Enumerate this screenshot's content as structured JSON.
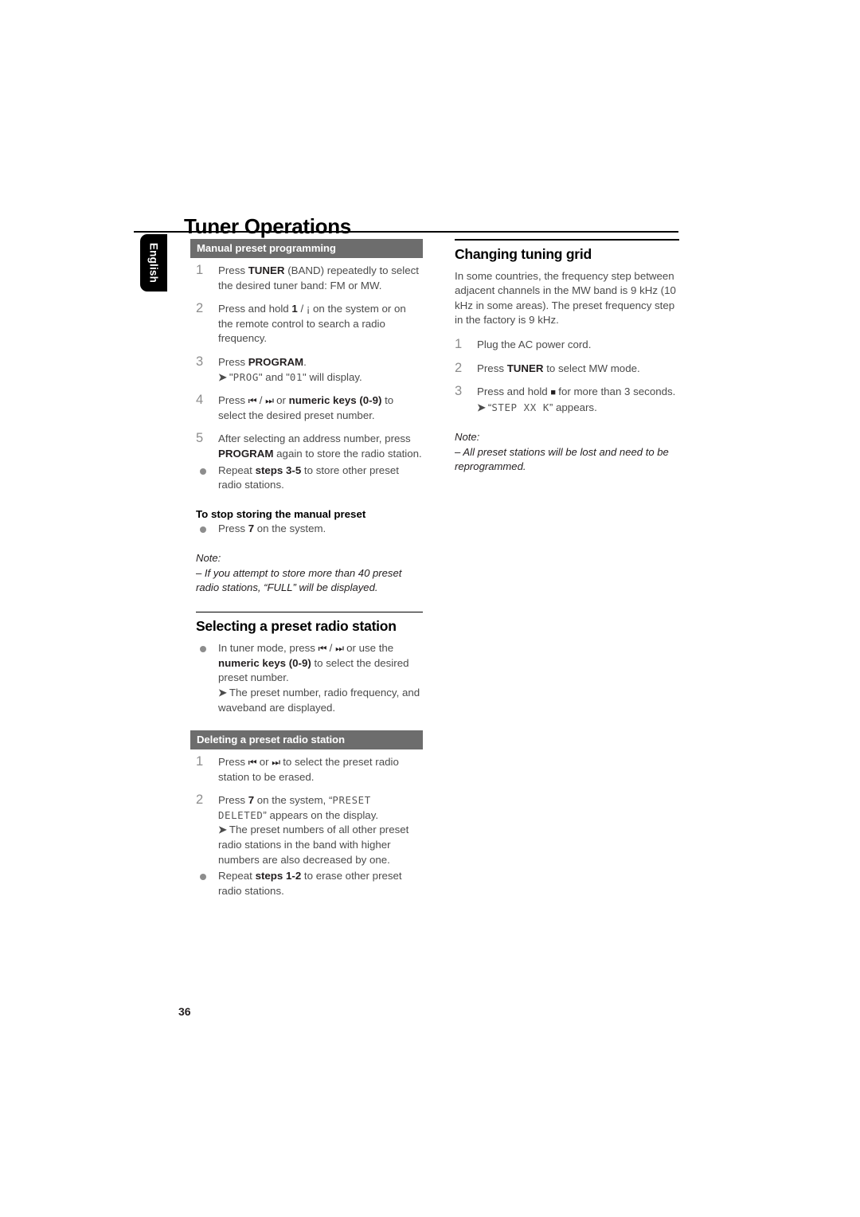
{
  "document": {
    "title": "Tuner Operations",
    "language_tab": "English",
    "page_number": "36"
  },
  "left_column": {
    "manual_preset": {
      "bar_heading": "Manual preset programming",
      "steps": [
        {
          "num": "1",
          "parts": [
            {
              "t": "Press ",
              "s": "n"
            },
            {
              "t": "TUNER",
              "s": "b"
            },
            {
              "t": " (BAND) repeatedly to select the desired tuner band: FM or MW.",
              "s": "n"
            }
          ]
        },
        {
          "num": "2",
          "parts": [
            {
              "t": "Press and hold ",
              "s": "n"
            },
            {
              "t": "1",
              "s": "b"
            },
            {
              "t": "    / ",
              "s": "n"
            },
            {
              "t": "¡",
              "s": "n"
            },
            {
              "t": "    on the system or on the remote control to search a radio frequency.",
              "s": "n"
            }
          ]
        },
        {
          "num": "3",
          "parts": [
            {
              "t": "Press ",
              "s": "n"
            },
            {
              "t": "PROGRAM",
              "s": "b"
            },
            {
              "t": ".",
              "s": "n"
            }
          ],
          "arrow": [
            {
              "t": "\"",
              "s": "n"
            },
            {
              "t": "PROG",
              "s": "lcd"
            },
            {
              "t": "\" and \"",
              "s": "n"
            },
            {
              "t": "01",
              "s": "lcd"
            },
            {
              "t": "\" will display.",
              "s": "n"
            }
          ]
        },
        {
          "num": "4",
          "parts": [
            {
              "t": "Press ",
              "s": "n"
            },
            {
              "t": "⏮",
              "s": "g"
            },
            {
              "t": " / ",
              "s": "n"
            },
            {
              "t": "⏭",
              "s": "g"
            },
            {
              "t": " or ",
              "s": "n"
            },
            {
              "t": "numeric keys (0-9)",
              "s": "b"
            },
            {
              "t": " to select the desired preset number.",
              "s": "n"
            }
          ]
        },
        {
          "num": "5",
          "parts": [
            {
              "t": "After selecting an address number, press ",
              "s": "n"
            },
            {
              "t": "PROGRAM",
              "s": "b"
            },
            {
              "t": " again to store the radio station.",
              "s": "n"
            }
          ]
        }
      ],
      "bullets": [
        {
          "parts": [
            {
              "t": "Repeat ",
              "s": "n"
            },
            {
              "t": "steps 3-5",
              "s": "b"
            },
            {
              "t": " to store other preset radio stations.",
              "s": "n"
            }
          ]
        }
      ],
      "stop_storing": {
        "heading": "To stop storing the manual preset",
        "bullet": [
          {
            "t": "Press ",
            "s": "n"
          },
          {
            "t": "7",
            "s": "b"
          },
          {
            "t": "  on the system.",
            "s": "n"
          }
        ]
      },
      "note": {
        "label": "Note:",
        "body": "–  If you attempt to store more than 40 preset radio stations, “FULL” will be displayed."
      }
    },
    "selecting_preset": {
      "heading": "Selecting a preset radio station",
      "bullet": [
        {
          "t": "In tuner mode, press ",
          "s": "n"
        },
        {
          "t": "⏮",
          "s": "g"
        },
        {
          "t": " / ",
          "s": "n"
        },
        {
          "t": "⏭",
          "s": "g"
        },
        {
          "t": " or use the ",
          "s": "n"
        },
        {
          "t": "numeric keys (0-9)",
          "s": "b"
        },
        {
          "t": " to select the desired preset number.",
          "s": "n"
        }
      ],
      "arrow": [
        {
          "t": "The preset number, radio frequency, and waveband are displayed.",
          "s": "n"
        }
      ]
    },
    "deleting_preset": {
      "bar_heading": "Deleting a preset radio station",
      "steps": [
        {
          "num": "1",
          "parts": [
            {
              "t": "Press ",
              "s": "n"
            },
            {
              "t": "⏮",
              "s": "g"
            },
            {
              "t": " or ",
              "s": "n"
            },
            {
              "t": "⏭",
              "s": "g"
            },
            {
              "t": " to select the preset radio station to be erased.",
              "s": "n"
            }
          ]
        },
        {
          "num": "2",
          "parts": [
            {
              "t": "Press ",
              "s": "n"
            },
            {
              "t": "7",
              "s": "b"
            },
            {
              "t": "  on the system, “",
              "s": "n"
            },
            {
              "t": "PRESET DELETED",
              "s": "lcd"
            },
            {
              "t": "” appears on the display.",
              "s": "n"
            }
          ],
          "arrow": [
            {
              "t": "The preset numbers of all other preset radio stations in the band with higher numbers are also decreased by one.",
              "s": "n"
            }
          ]
        }
      ],
      "bullets": [
        {
          "parts": [
            {
              "t": "Repeat ",
              "s": "n"
            },
            {
              "t": "steps 1-2",
              "s": "b"
            },
            {
              "t": " to erase other preset radio stations.",
              "s": "n"
            }
          ]
        }
      ]
    }
  },
  "right_column": {
    "changing_grid": {
      "heading": "Changing tuning grid",
      "intro": "In some countries, the frequency step between adjacent channels in the MW band is 9 kHz (10 kHz in some areas). The preset frequency step in the factory is 9 kHz.",
      "steps": [
        {
          "num": "1",
          "parts": [
            {
              "t": "Plug the AC power cord.",
              "s": "n"
            }
          ]
        },
        {
          "num": "2",
          "parts": [
            {
              "t": "Press ",
              "s": "n"
            },
            {
              "t": "TUNER",
              "s": "b"
            },
            {
              "t": " to select MW mode.",
              "s": "n"
            }
          ]
        },
        {
          "num": "3",
          "parts": [
            {
              "t": "Press and hold ",
              "s": "n"
            },
            {
              "t": "■",
              "s": "gs"
            },
            {
              "t": " for more than 3 seconds.",
              "s": "n"
            }
          ],
          "arrow": [
            {
              "t": "“",
              "s": "n"
            },
            {
              "t": "STEP  XX K",
              "s": "lcd"
            },
            {
              "t": "” appears.",
              "s": "n"
            }
          ]
        }
      ],
      "note": {
        "label": "Note:",
        "body": "–  All preset stations will be lost and need to be reprogrammed."
      }
    }
  },
  "colors": {
    "bar_heading_bg": "#6d6d6d",
    "body_text": "#4b4b4b",
    "step_number": "#8d8d8d",
    "lcd_text": "#565656",
    "rule": "#000000",
    "tab_bg": "#000000"
  }
}
